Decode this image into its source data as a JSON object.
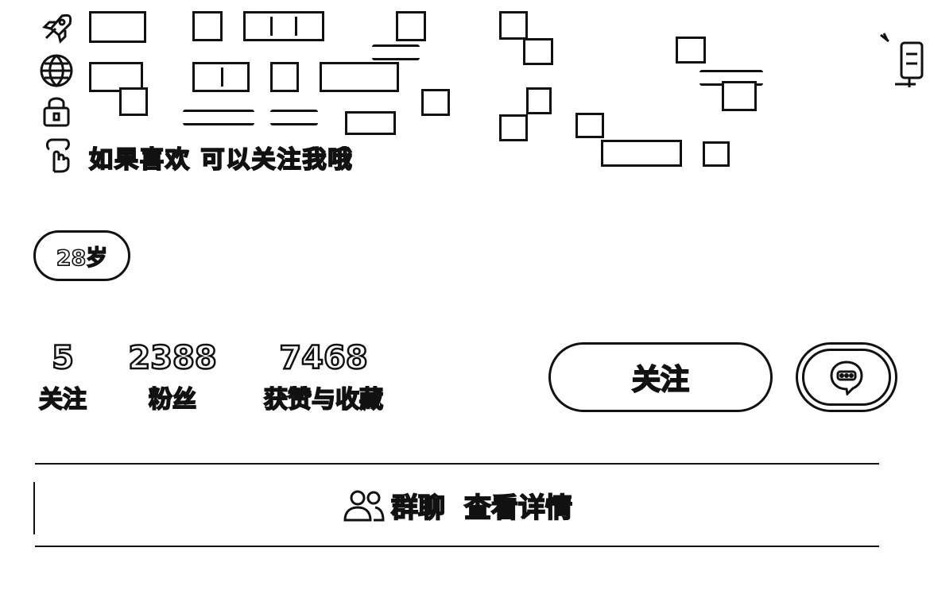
{
  "bio": {
    "line4_text": "如果喜欢 可以关注我哦"
  },
  "profile": {
    "age_tag": "28岁"
  },
  "stats": {
    "following_count": "5",
    "following_label": "关注",
    "followers_count": "2388",
    "followers_label": "粉丝",
    "likes_count": "7468",
    "likes_label": "获赞与收藏"
  },
  "actions": {
    "follow_label": "关注"
  },
  "group_chat": {
    "title": "群聊",
    "link_text": "查看详情"
  },
  "icons": {
    "line1": "rocket-icon",
    "line2": "globe-icon",
    "line3": "lock-icon",
    "line4": "pointing-down-icon",
    "chat": "chat-bubble-icon",
    "group": "people-icon"
  }
}
